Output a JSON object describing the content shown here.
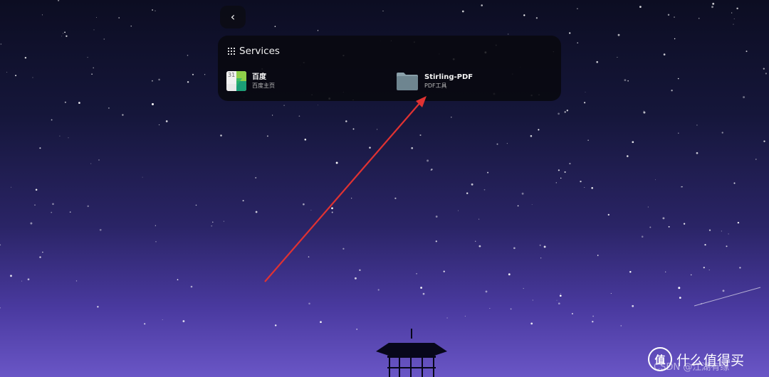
{
  "nav": {
    "back_icon": "chevron-left-icon",
    "back_glyph": "‹"
  },
  "services": {
    "title": "Services",
    "header_icon": "grid-icon",
    "items": [
      {
        "name": "百度",
        "description": "百度主页",
        "icon": "calendar-icon",
        "icon_number": "31"
      },
      {
        "name": "Stirling-PDF",
        "description": "PDF工具",
        "icon": "folder-icon"
      }
    ]
  },
  "annotation": {
    "arrow_color": "#e03232"
  },
  "watermark": {
    "logo": "值",
    "text": "什么值得买",
    "sub": "CSDN @江湖有缘"
  }
}
